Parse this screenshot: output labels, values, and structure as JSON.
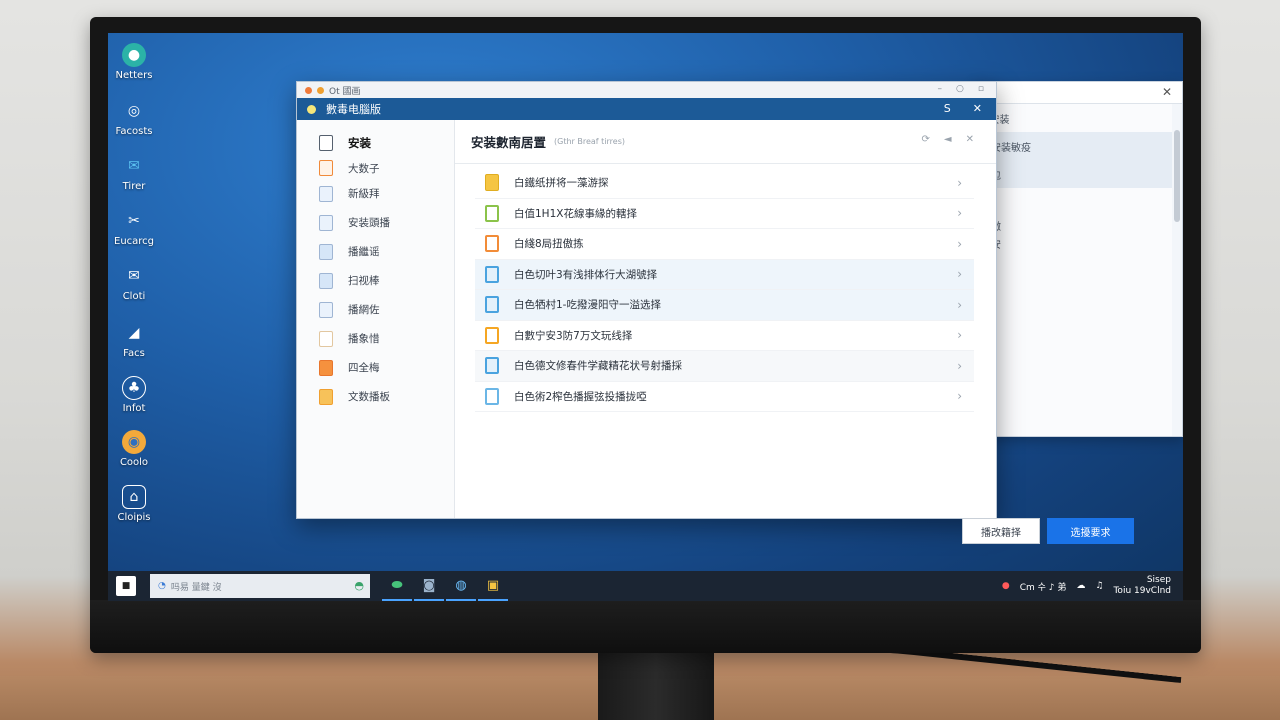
{
  "desktop": {
    "icons": [
      {
        "label": "Netters",
        "icon": "app-icon",
        "color": "#2bb3a7"
      },
      {
        "label": "Facosts",
        "icon": "search-icon",
        "color": "#ffffff"
      },
      {
        "label": "Tirer",
        "icon": "mail-icon",
        "color": "#5bc2f0"
      },
      {
        "label": "Eucarcg",
        "icon": "tools-icon",
        "color": "#ffffff"
      },
      {
        "label": "Cloti",
        "icon": "envelope-icon",
        "color": "#ffffff"
      },
      {
        "label": "Facs",
        "icon": "chart-icon",
        "color": "#ffffff"
      },
      {
        "label": "Infot",
        "icon": "app-icon",
        "color": "#ffffff"
      },
      {
        "label": "Coolo",
        "icon": "browser-icon",
        "color": "#f2a93b"
      },
      {
        "label": "Cloipis",
        "icon": "app-icon",
        "color": "#ffffff"
      }
    ]
  },
  "window": {
    "outer_title": "Ot 國画",
    "title": "數毒电腦版",
    "title_controls": [
      "S",
      "✕"
    ],
    "sidebar": {
      "items": [
        {
          "label": "安装",
          "active": true
        },
        {
          "label": "大数子"
        },
        {
          "label": "新級拜"
        },
        {
          "label": "安装頭播"
        },
        {
          "label": "播繼谣"
        },
        {
          "label": "扫视棒"
        },
        {
          "label": "播網佐"
        },
        {
          "label": "播象惜"
        },
        {
          "label": "四全梅"
        },
        {
          "label": "文数播板"
        }
      ]
    },
    "content": {
      "title": "安装數南居置",
      "subtitle": "(Gthr Breaf tirres)",
      "rows": [
        {
          "label": "白鐵纸拼将一藻游探",
          "icon_color": "#f5c542"
        },
        {
          "label": "白值1H1X花線事緣的轄择",
          "icon_color": "#8bc34a"
        },
        {
          "label": "白綫8局扭傲拣",
          "icon_color": "#f28c38"
        },
        {
          "label": "白色切叶3有浅排体行大湖號择",
          "icon_color": "#4aa3df",
          "highlight": "blue"
        },
        {
          "label": "白色牺村1-吃撥漫阳守一溢选择",
          "icon_color": "#4aa3df",
          "highlight": "blue"
        },
        {
          "label": "白數宁安3防7万文玩线择",
          "icon_color": "#f5a623"
        },
        {
          "label": "白色德文修春件学藏精花状号射播採",
          "icon_color": "#4aa3df",
          "highlight": "grey"
        },
        {
          "label": "白色術2榨色播握弦投播拢啞",
          "icon_color": "#6bb6e6"
        }
      ],
      "secondary_button": "播改籍择",
      "primary_button": "选擾要求"
    }
  },
  "background_window": {
    "rows": [
      "ॉ安装",
      "阿安装敏疫",
      "脱包",
      "",
      "成徵",
      "冷安"
    ]
  },
  "taskbar": {
    "search_placeholder": "吗易 量鍵 沒",
    "tray_text": "Cm 수 ♪ 弟",
    "clock_time": "Sisep",
    "clock_date": "Toiu 19vClnd"
  }
}
